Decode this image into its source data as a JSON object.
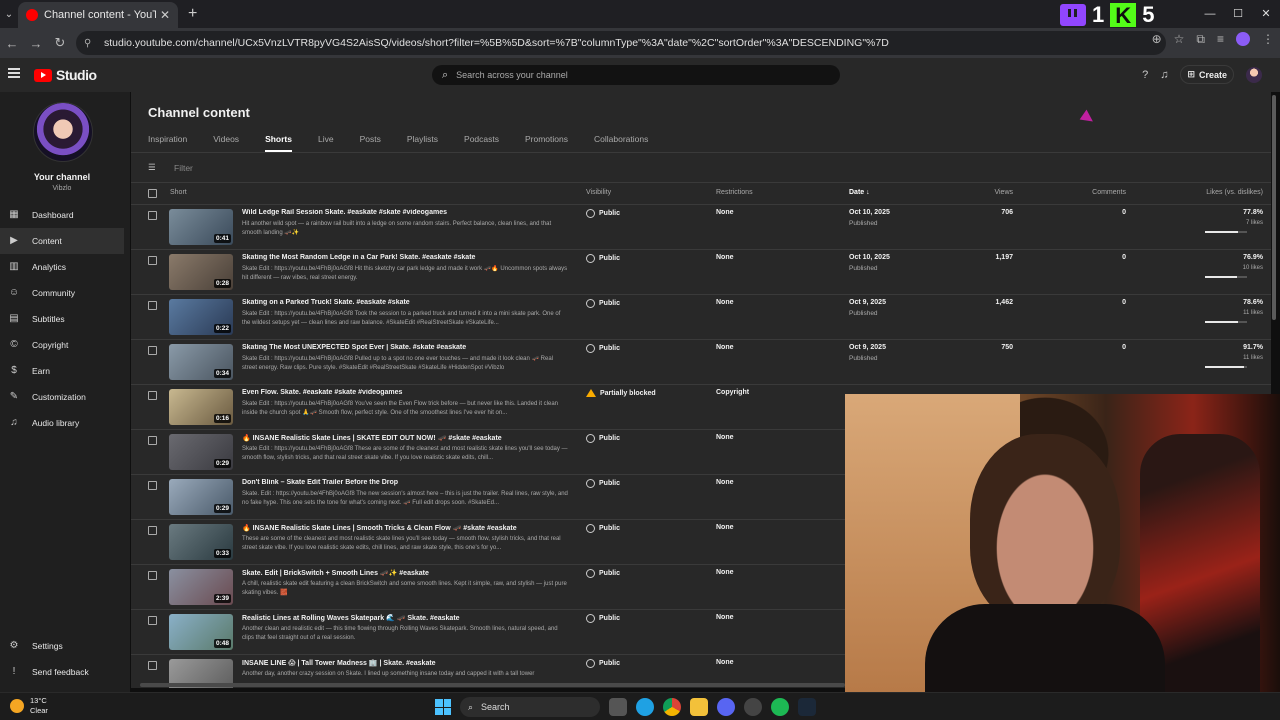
{
  "browser": {
    "tab_title": "Channel content - YouTube Studio",
    "url": "studio.youtube.com/channel/UCx5VnzLVTR8pyVG4S2AisSQ/videos/short?filter=%5B%5D&sort=%7B\"columnType\"%3A\"date\"%2C\"sortOrder\"%3A\"DESCENDING\"%7D",
    "overlay_nums": [
      "1",
      "5"
    ]
  },
  "studio": {
    "logo_text": "Studio",
    "search_placeholder": "Search across your channel",
    "create_label": "Create"
  },
  "sidebar": {
    "channel_name": "Your channel",
    "channel_handle": "Vibzlo",
    "items": [
      {
        "label": "Dashboard",
        "icon": "dashboard-icon",
        "glyph": "▦"
      },
      {
        "label": "Content",
        "icon": "content-icon",
        "glyph": "▶"
      },
      {
        "label": "Analytics",
        "icon": "analytics-icon",
        "glyph": "▥"
      },
      {
        "label": "Community",
        "icon": "community-icon",
        "glyph": "☺"
      },
      {
        "label": "Subtitles",
        "icon": "subtitles-icon",
        "glyph": "▤"
      },
      {
        "label": "Copyright",
        "icon": "copyright-icon",
        "glyph": "©"
      },
      {
        "label": "Earn",
        "icon": "earn-icon",
        "glyph": "$"
      },
      {
        "label": "Customization",
        "icon": "customization-icon",
        "glyph": "✎"
      },
      {
        "label": "Audio library",
        "icon": "audio-library-icon",
        "glyph": "♫"
      }
    ],
    "bottom": [
      {
        "label": "Settings",
        "icon": "settings-icon",
        "glyph": "⚙"
      },
      {
        "label": "Send feedback",
        "icon": "feedback-icon",
        "glyph": "!"
      }
    ]
  },
  "main": {
    "title": "Channel content",
    "tabs": [
      "Inspiration",
      "Videos",
      "Shorts",
      "Live",
      "Posts",
      "Playlists",
      "Podcasts",
      "Promotions",
      "Collaborations"
    ],
    "active_tab": "Shorts",
    "filter_placeholder": "Filter",
    "columns": {
      "short": "Short",
      "visibility": "Visibility",
      "restrictions": "Restrictions",
      "date": "Date ↓",
      "views": "Views",
      "comments": "Comments",
      "likes": "Likes (vs. dislikes)"
    }
  },
  "rows": [
    {
      "title": "Wild Ledge Rail Session Skate. #easkate #skate #videogames",
      "desc": "Hit another wild spot — a rainbow rail built into a ledge on some random stairs. Perfect balance, clean lines, and that smooth landing 🛹✨",
      "duration": "0:41",
      "visibility": "Public",
      "restrictions": "None",
      "date": "Oct 10, 2025",
      "status": "Published",
      "views": "706",
      "comments": "0",
      "likes_pct": "77.8%",
      "likes": "7 likes",
      "like_ratio": 0.778,
      "colors": [
        "#7a8c9a",
        "#3a4a5a"
      ]
    },
    {
      "title": "Skating the Most Random Ledge in a Car Park! Skate. #easkate #skate",
      "desc": "Skate Edit : https://youtu.be/4FhBj0oAGf8 Hit this sketchy car park ledge and made it work 🛹🔥 Uncommon spots always hit different — raw vibes, real street energy.",
      "duration": "0:28",
      "visibility": "Public",
      "restrictions": "None",
      "date": "Oct 10, 2025",
      "status": "Published",
      "views": "1,197",
      "comments": "0",
      "likes_pct": "76.9%",
      "likes": "10 likes",
      "like_ratio": 0.769,
      "colors": [
        "#8a7a6a",
        "#4a4038"
      ]
    },
    {
      "title": "Skating on a Parked Truck! Skate. #easkate #skate",
      "desc": "Skate Edit : https://youtu.be/4FhBj0oAGf8 Took the session to a parked truck and turned it into a mini skate park. One of the wildest setups yet — clean lines and raw balance. #SkateEdit #RealStreetSkate #SkateLife...",
      "duration": "0:22",
      "visibility": "Public",
      "restrictions": "None",
      "date": "Oct 9, 2025",
      "status": "Published",
      "views": "1,462",
      "comments": "0",
      "likes_pct": "78.6%",
      "likes": "11 likes",
      "like_ratio": 0.786,
      "colors": [
        "#5a7aa0",
        "#2a3a55"
      ]
    },
    {
      "title": "Skating The Most UNEXPECTED Spot Ever | Skate. #skate #easkate",
      "desc": "Skate Edit : https://youtu.be/4FhBj0oAGf8 Pulled up to a spot no one ever touches — and made it look clean 🛹 Real street energy. Raw clips. Pure style. #SkateEdit #RealStreetSkate #SkateLife #HiddenSpot #Vibzlo",
      "duration": "0:34",
      "visibility": "Public",
      "restrictions": "None",
      "date": "Oct 9, 2025",
      "status": "Published",
      "views": "750",
      "comments": "0",
      "likes_pct": "91.7%",
      "likes": "11 likes",
      "like_ratio": 0.917,
      "colors": [
        "#8a9aa8",
        "#4a5560"
      ]
    },
    {
      "title": "Even Flow. Skate. #easkate #skate #videogames",
      "desc": "Skate Edit : https://youtu.be/4FhBj0oAGf8 You've seen the Even Flow trick before — but never like this. Landed it clean inside the church spot 🙏🛹 Smooth flow, perfect style. One of the smoothest lines I've ever hit on...",
      "duration": "0:16",
      "visibility": "Partially blocked",
      "warn": true,
      "restrictions": "Copyright",
      "date": "",
      "status": "",
      "views": "",
      "comments": "",
      "likes_pct": "",
      "likes": "",
      "like_ratio": null,
      "colors": [
        "#c8b890",
        "#6a5a40"
      ]
    },
    {
      "title": "🔥 INSANE Realistic Skate Lines | SKATE EDIT OUT NOW! 🛹 #skate #easkate",
      "desc": "Skate Edit : https://youtu.be/4FhBj0oAGf8 These are some of the cleanest and most realistic skate lines you'll see today — smooth flow, stylish tricks, and that real street skate vibe. If you love realistic skate edits, chill...",
      "duration": "0:29",
      "visibility": "Public",
      "restrictions": "None",
      "date": "",
      "status": "",
      "views": "",
      "comments": "",
      "likes_pct": "",
      "likes": "",
      "like_ratio": null,
      "colors": [
        "#6a6a70",
        "#3a3a40"
      ]
    },
    {
      "title": "Don't Blink – Skate Edit Trailer Before the Drop",
      "desc": "Skate. Edit : https://youtu.be/4FhBj0oAGf8 The new session's almost here – this is just the trailer. Real lines, raw style, and no fake hype. This one sets the tone for what's coming next. 🛹 Full edit drops soon. #SkateEd...",
      "duration": "0:29",
      "visibility": "Public",
      "restrictions": "None",
      "date": "",
      "status": "",
      "views": "",
      "comments": "",
      "likes_pct": "",
      "likes": "",
      "like_ratio": null,
      "colors": [
        "#9aaabb",
        "#4a5a6a"
      ]
    },
    {
      "title": "🔥 INSANE Realistic Skate Lines | Smooth Tricks & Clean Flow 🛹 #skate #easkate",
      "desc": "These are some of the cleanest and most realistic skate lines you'll see today — smooth flow, stylish tricks, and that real street skate vibe. If you love realistic skate edits, chill lines, and raw skate style, this one's for yo...",
      "duration": "0:33",
      "visibility": "Public",
      "restrictions": "None",
      "date": "",
      "status": "",
      "views": "",
      "comments": "",
      "likes_pct": "",
      "likes": "",
      "like_ratio": null,
      "colors": [
        "#6a7a80",
        "#2a3a40"
      ]
    },
    {
      "title": "Skate. Edit | BrickSwitch + Smooth Lines 🛹✨ #easkate",
      "desc": "A chill, realistic skate edit featuring a clean BrickSwitch and some smooth lines. Kept it simple, raw, and stylish — just pure skating vibes. 🧱",
      "duration": "2:39",
      "visibility": "Public",
      "restrictions": "None",
      "date": "",
      "status": "",
      "views": "",
      "comments": "",
      "likes_pct": "",
      "likes": "",
      "like_ratio": null,
      "colors": [
        "#8a90a0",
        "#6a4a50"
      ]
    },
    {
      "title": "Realistic Lines at Rolling Waves Skatepark 🌊 🛹 Skate. #easkate",
      "desc": "Another clean and realistic edit — this time flowing through Rolling Waves Skatepark. Smooth lines, natural speed, and clips that feel straight out of a real session.",
      "duration": "0:48",
      "visibility": "Public",
      "restrictions": "None",
      "date": "",
      "status": "",
      "views": "",
      "comments": "",
      "likes_pct": "",
      "likes": "",
      "like_ratio": null,
      "colors": [
        "#8ab0c8",
        "#5a7a6a"
      ]
    },
    {
      "title": "INSANE LINE 😱 | Tall Tower Madness 🏢 | Skate. #easkate",
      "desc": "Another day, another crazy session on Skate. I lined up something insane today and capped it with a tall tower",
      "duration": "",
      "visibility": "Public",
      "restrictions": "None",
      "date": "",
      "status": "",
      "views": "",
      "comments": "",
      "likes_pct": "",
      "likes": "",
      "like_ratio": null,
      "colors": [
        "#9a9a9a",
        "#5a5a5a"
      ]
    }
  ],
  "taskbar": {
    "temp": "13°C",
    "condition": "Clear",
    "search_label": "Search"
  }
}
